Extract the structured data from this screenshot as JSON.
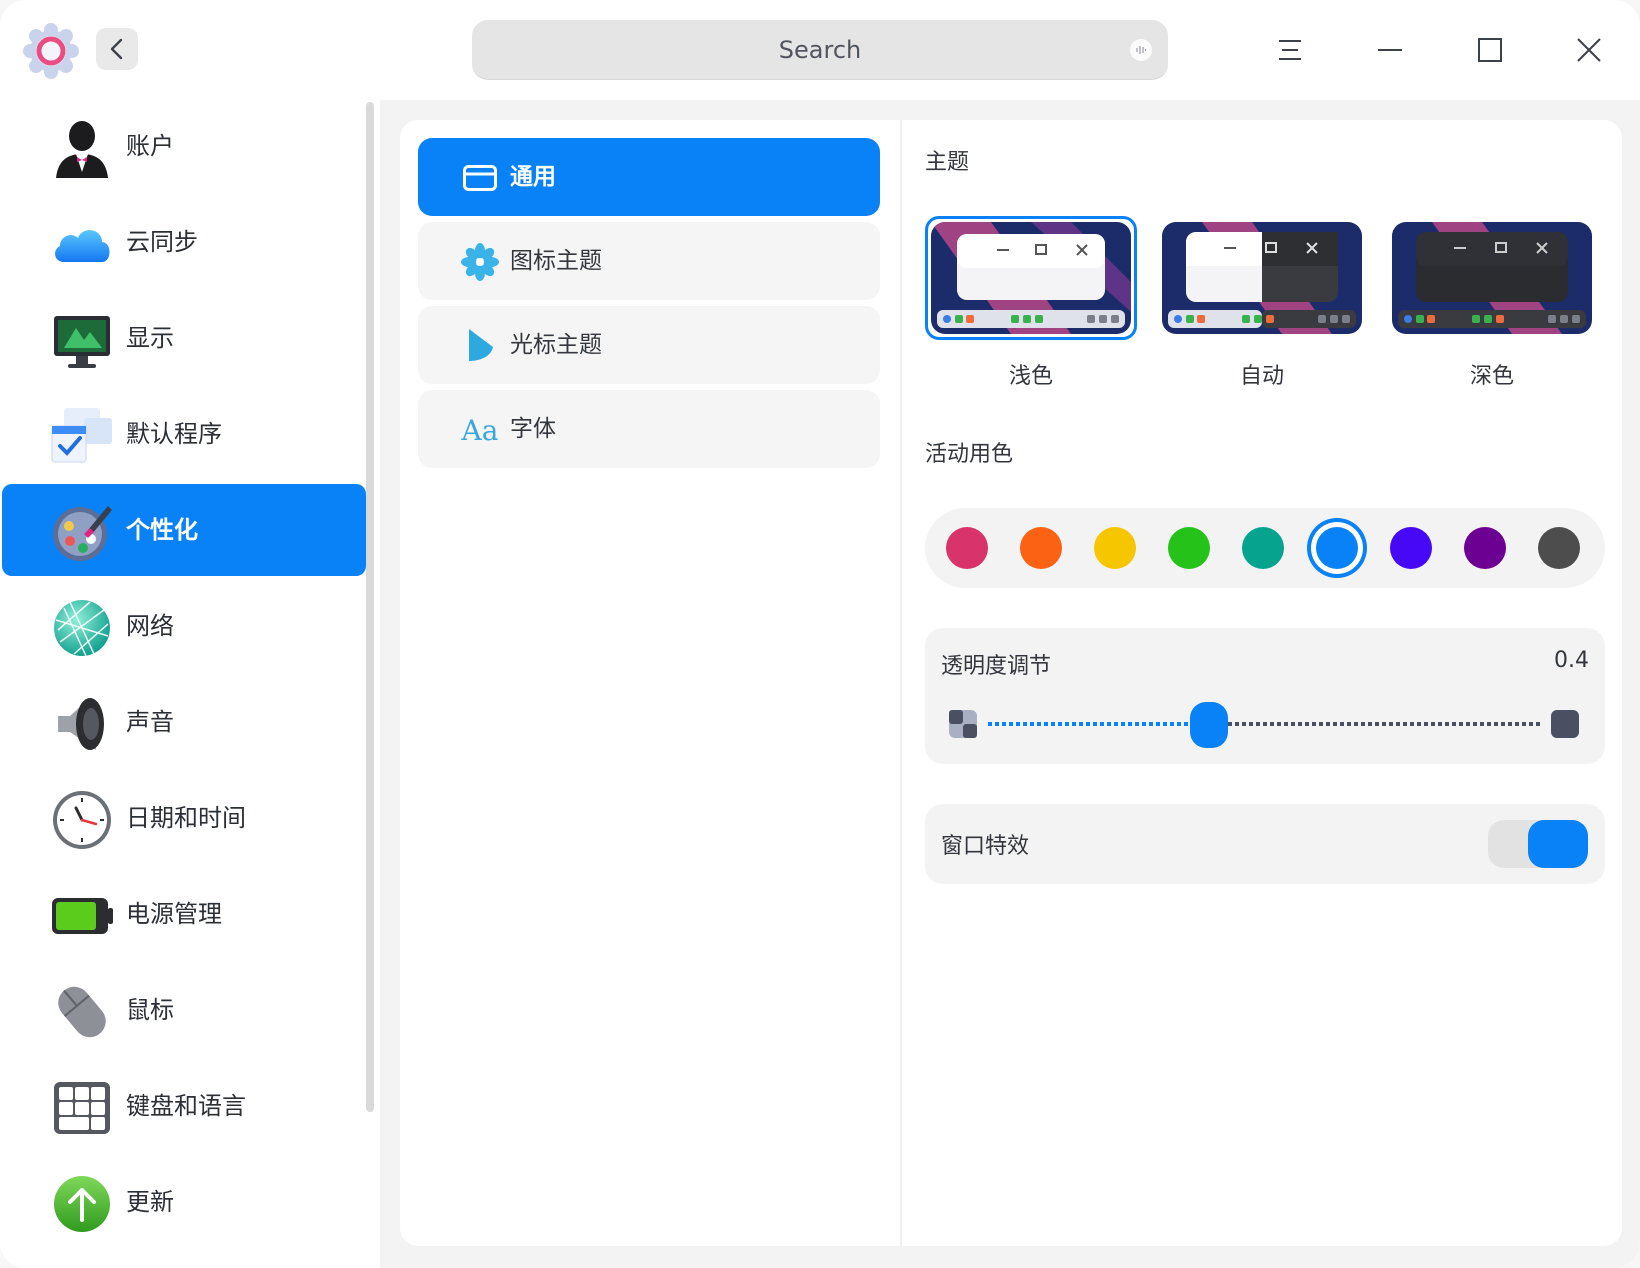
{
  "titlebar": {
    "search_placeholder": "Search",
    "icons": [
      "app-icon",
      "back-icon",
      "voice-icon",
      "menu-icon",
      "minimize-icon",
      "maximize-icon",
      "close-icon"
    ]
  },
  "sidebar": {
    "items": [
      {
        "label": "账户",
        "icon": "account-icon"
      },
      {
        "label": "云同步",
        "icon": "cloud-icon"
      },
      {
        "label": "显示",
        "icon": "monitor-icon"
      },
      {
        "label": "默认程序",
        "icon": "default-apps-icon"
      },
      {
        "label": "个性化",
        "icon": "palette-icon",
        "active": true
      },
      {
        "label": "网络",
        "icon": "network-globe-icon"
      },
      {
        "label": "声音",
        "icon": "speaker-icon"
      },
      {
        "label": "日期和时间",
        "icon": "clock-icon"
      },
      {
        "label": "电源管理",
        "icon": "battery-icon"
      },
      {
        "label": "鼠标",
        "icon": "mouse-icon"
      },
      {
        "label": "键盘和语言",
        "icon": "keyboard-icon"
      },
      {
        "label": "更新",
        "icon": "update-arrow-icon"
      }
    ]
  },
  "subnav": {
    "items": [
      {
        "label": "通用",
        "icon": "window-icon",
        "active": true
      },
      {
        "label": "图标主题",
        "icon": "flower-icon"
      },
      {
        "label": "光标主题",
        "icon": "cursor-icon"
      },
      {
        "label": "字体",
        "icon": "font-icon",
        "icon_text": "Aa"
      }
    ]
  },
  "content": {
    "theme_title": "主题",
    "themes": [
      {
        "label": "浅色",
        "selected": true
      },
      {
        "label": "自动"
      },
      {
        "label": "深色"
      }
    ],
    "accent_title": "活动用色",
    "accent_colors": [
      "#d8336a",
      "#fc6213",
      "#f6c600",
      "#25c21a",
      "#06a38e",
      "#0a82f7",
      "#4709f5",
      "#6c0092",
      "#4d4d4d"
    ],
    "accent_selected_index": 5,
    "transparency": {
      "label": "透明度调节",
      "value": "0.4",
      "level": 0.4
    },
    "window_effect": {
      "label": "窗口特效",
      "enabled": true
    }
  }
}
